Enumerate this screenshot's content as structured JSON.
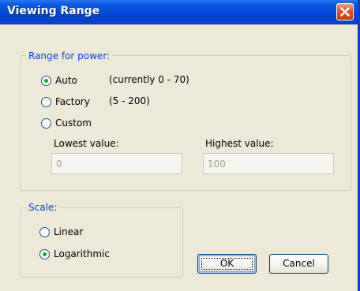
{
  "window": {
    "title": "Viewing Range",
    "close_icon": "close-icon"
  },
  "range": {
    "legend": "Range for power:",
    "options": [
      {
        "label": "Auto",
        "note": "(currently 0  -  70)",
        "selected": true
      },
      {
        "label": "Factory",
        "note": "(5  -  200)",
        "selected": false
      },
      {
        "label": "Custom",
        "note": "",
        "selected": false
      }
    ],
    "lowest_label": "Lowest value:",
    "lowest_value": "0",
    "highest_label": "Highest value:",
    "highest_value": "100"
  },
  "scale": {
    "legend": "Scale:",
    "options": [
      {
        "label": "Linear",
        "selected": false
      },
      {
        "label": "Logarithmic",
        "selected": true
      }
    ]
  },
  "buttons": {
    "ok": "OK",
    "cancel": "Cancel"
  },
  "colors": {
    "titlebar": "#0548d6",
    "legend_text": "#0046d5",
    "radio_dot": "#21a121"
  }
}
